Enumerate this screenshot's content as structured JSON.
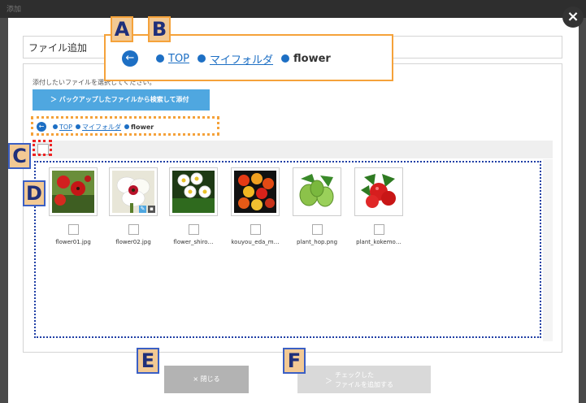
{
  "background": {
    "title": "添加"
  },
  "dialog": {
    "title": "ファイル追加",
    "close_symbol": "×",
    "instruction": "添付したいファイルを選択してください。",
    "search_button": "＞ バックアップしたファイルから検索して添付"
  },
  "breadcrumb": {
    "back_symbol": "←",
    "items": [
      "TOP",
      "マイフォルダ"
    ],
    "current": "flower"
  },
  "files": [
    {
      "name": "flower01.jpg",
      "icon": "red-poppies-thumbnail"
    },
    {
      "name": "flower02.jpg",
      "icon": "white-flower-thumbnail"
    },
    {
      "name": "flower_shiro…",
      "icon": "white-flowers-illustration-thumbnail"
    },
    {
      "name": "kouyou_eda_m…",
      "icon": "autumn-leaves-thumbnail"
    },
    {
      "name": "plant_hop.png",
      "icon": "hop-plant-thumbnail"
    },
    {
      "name": "plant_kokemo…",
      "icon": "kokemomo-berries-thumbnail"
    }
  ],
  "footer": {
    "close_label": "× 閉じる",
    "add_arrow": "＞",
    "add_line1": "チェックした",
    "add_line2": "ファイルを追加する"
  },
  "annotations": {
    "A": "A",
    "B": "B",
    "C": "C",
    "D": "D",
    "E": "E",
    "F": "F"
  },
  "colors": {
    "accent_blue": "#4fa7e0",
    "link_blue": "#1d6fc4",
    "annotation_orange": "#f5a23a",
    "annotation_red": "#e22222",
    "annotation_navy": "#1f3fa5"
  }
}
